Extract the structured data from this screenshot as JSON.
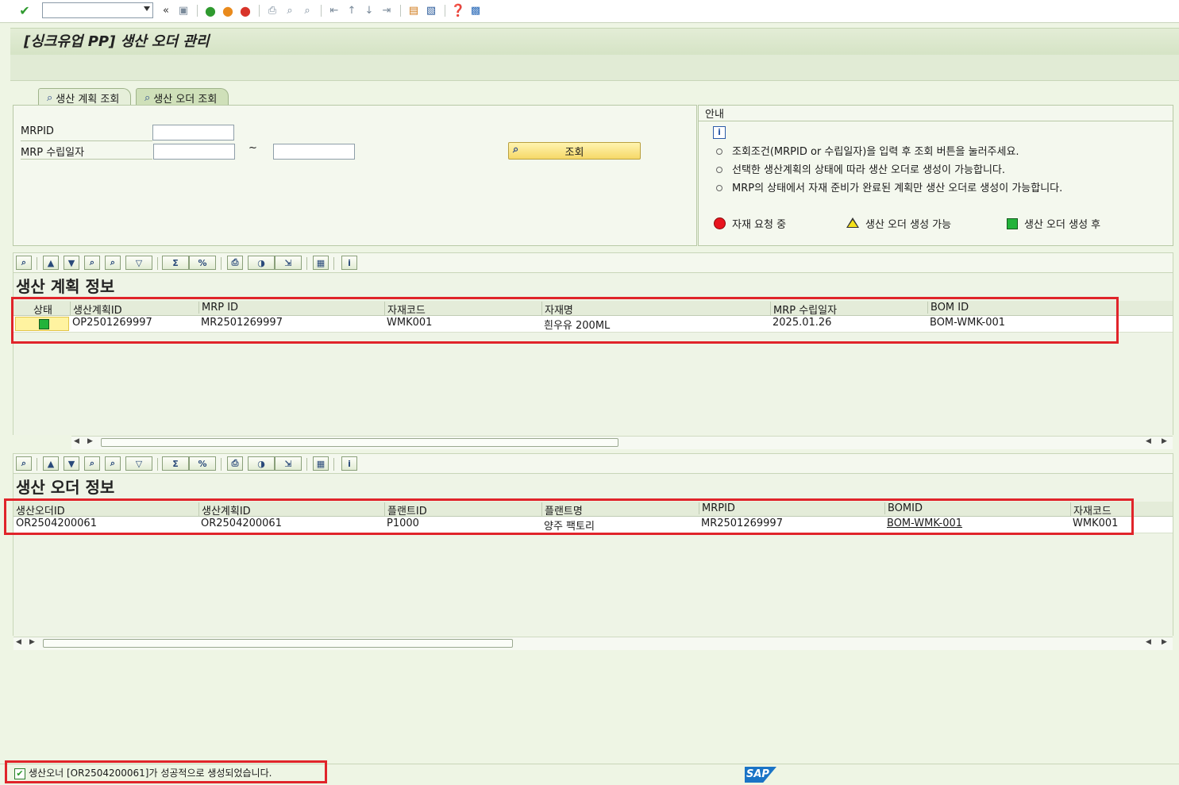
{
  "window": {
    "title": "[싱크유업 PP] 생산 오더 관리"
  },
  "toolbar": {
    "nav_back_glyph": "«"
  },
  "tabs": [
    {
      "label": "생산 계획 조회",
      "active": false
    },
    {
      "label": "생산 오더 조회",
      "active": true
    }
  ],
  "form": {
    "mrpid_label": "MRPID",
    "mrpid_value": "",
    "date_label": "MRP 수립일자",
    "date_from": "",
    "date_to": "",
    "range_sep": "~",
    "search_label": "조회"
  },
  "info": {
    "title": "안내",
    "lines": [
      "조회조건(MRPID or 수립일자)을 입력 후 조회 버튼을 눌러주세요.",
      "선택한 생산계획의 상태에 따라 생산 오더로 생성이 가능합니다.",
      "MRP의 상태에서 자재 준비가 완료된 계획만 생산 오더로 생성이 가능합니다."
    ],
    "legend": [
      {
        "label": "자재 요청 중",
        "color": "#e8141e"
      },
      {
        "label": "생산 오더 생성 가능",
        "color": "#f5e21a"
      },
      {
        "label": "생산 오더 생성 후",
        "color": "#22b33a"
      }
    ]
  },
  "plan_grid": {
    "title": "생산 계획 정보",
    "columns": [
      "상태",
      "생산계획ID",
      "MRP ID",
      "자재코드",
      "자재명",
      "MRP 수립일자",
      "BOM ID"
    ],
    "rows": [
      {
        "status_color": "#22b33a",
        "plan_id": "OP2501269997",
        "mrp_id": "MR2501269997",
        "material_code": "WMK001",
        "material_name": "흰우유 200ML",
        "mrp_date": "2025.01.26",
        "bom_id": "BOM-WMK-001"
      }
    ]
  },
  "order_grid": {
    "title": "생산 오더 정보",
    "columns": [
      "생산오더ID",
      "생산계획ID",
      "플랜트ID",
      "플랜트명",
      "MRPID",
      "BOMID",
      "자재코드"
    ],
    "rows": [
      {
        "order_id": "OR2504200061",
        "plan_id": "OR2504200061",
        "plant_id": "P1000",
        "plant_name": "양주 팩토리",
        "mrpid": "MR2501269997",
        "bomid": "BOM-WMK-001",
        "material_code": "WMK001"
      }
    ]
  },
  "status": {
    "message": "생산오너 [OR2504200061]가 성공적으로 생성되었습니다.",
    "brand": "SAP",
    "brand_color": "#1a74c6"
  },
  "colors": {
    "accent_green": "#cfe0b9",
    "highlight_red": "#e0242a"
  }
}
